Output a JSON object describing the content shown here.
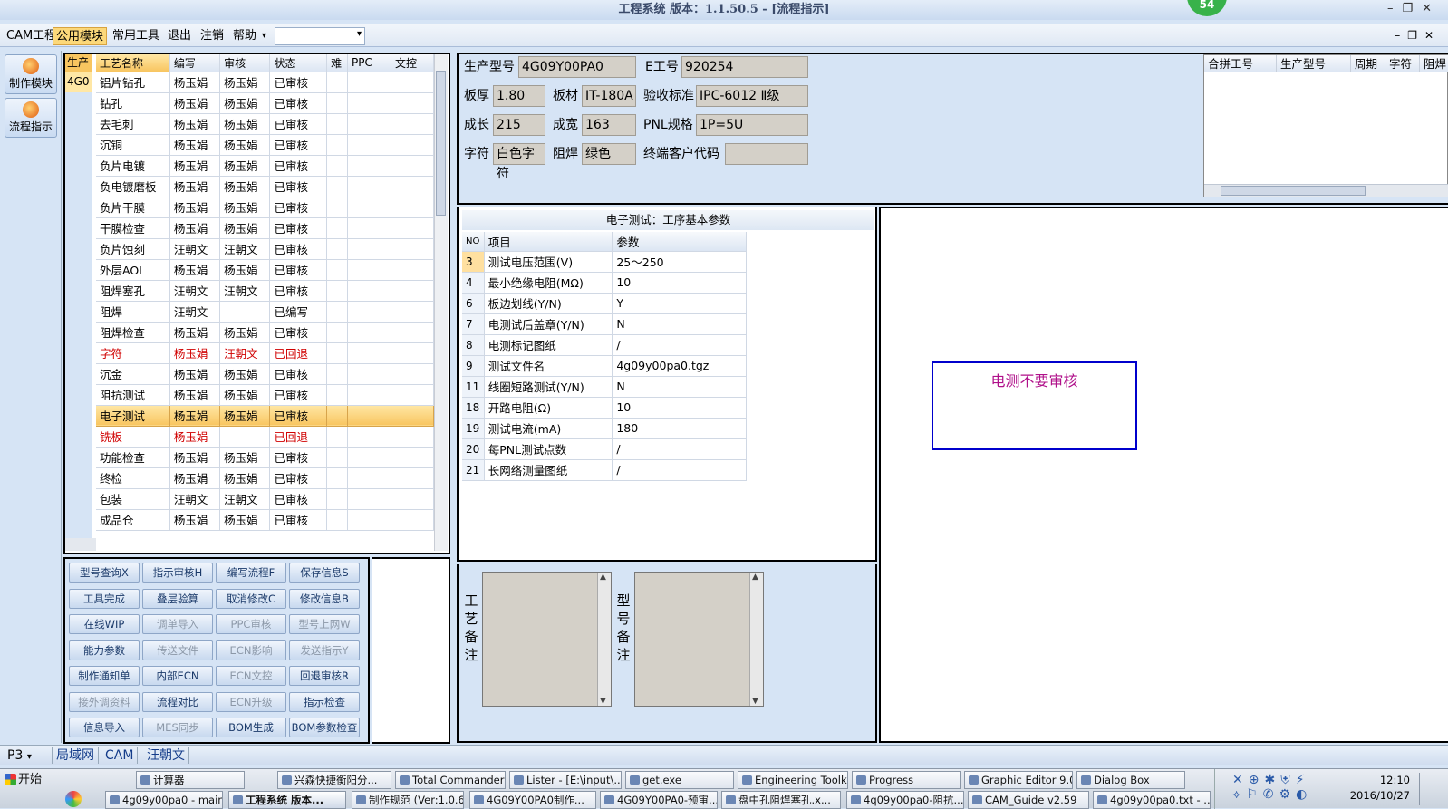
{
  "window": {
    "title": "工程系统  版本：1.1.50.5 - [流程指示]",
    "badge": "54"
  },
  "menu": {
    "items": [
      "CAM工程",
      "公用模块",
      "常用工具",
      "退出",
      "注销",
      "帮助"
    ],
    "active_index": 1,
    "dropdown_arrow": "▾"
  },
  "rail": {
    "buttons": [
      "制作模块",
      "流程指示"
    ]
  },
  "prod_column": {
    "header": "生产",
    "value": "4G0"
  },
  "process_table": {
    "headers": [
      "工艺名称",
      "编写",
      "审核",
      "状态",
      "难",
      "PPC",
      "文控"
    ],
    "rows": [
      [
        "铝片钻孔",
        "杨玉娟",
        "杨玉娟",
        "已审核"
      ],
      [
        "钻孔",
        "杨玉娟",
        "杨玉娟",
        "已审核"
      ],
      [
        "去毛刺",
        "杨玉娟",
        "杨玉娟",
        "已审核"
      ],
      [
        "沉铜",
        "杨玉娟",
        "杨玉娟",
        "已审核"
      ],
      [
        "负片电镀",
        "杨玉娟",
        "杨玉娟",
        "已审核"
      ],
      [
        "负电镀磨板",
        "杨玉娟",
        "杨玉娟",
        "已审核"
      ],
      [
        "负片干膜",
        "杨玉娟",
        "杨玉娟",
        "已审核"
      ],
      [
        "干膜检查",
        "杨玉娟",
        "杨玉娟",
        "已审核"
      ],
      [
        "负片蚀刻",
        "汪朝文",
        "汪朝文",
        "已审核"
      ],
      [
        "外层AOI",
        "杨玉娟",
        "杨玉娟",
        "已审核"
      ],
      [
        "阻焊塞孔",
        "汪朝文",
        "汪朝文",
        "已审核"
      ],
      [
        "阻焊",
        "汪朝文",
        "",
        "已编写"
      ],
      [
        "阻焊检查",
        "杨玉娟",
        "杨玉娟",
        "已审核"
      ],
      [
        "字符",
        "杨玉娟",
        "汪朝文",
        "已回退"
      ],
      [
        "沉金",
        "杨玉娟",
        "杨玉娟",
        "已审核"
      ],
      [
        "阻抗测试",
        "杨玉娟",
        "杨玉娟",
        "已审核"
      ],
      [
        "电子测试",
        "杨玉娟",
        "杨玉娟",
        "已审核"
      ],
      [
        "铣板",
        "杨玉娟",
        "",
        "已回退"
      ],
      [
        "功能检查",
        "杨玉娟",
        "杨玉娟",
        "已审核"
      ],
      [
        "终检",
        "杨玉娟",
        "杨玉娟",
        "已审核"
      ],
      [
        "包装",
        "汪朝文",
        "汪朝文",
        "已审核"
      ],
      [
        "成品仓",
        "杨玉娟",
        "杨玉娟",
        "已审核"
      ]
    ],
    "red_rows": [
      13,
      17
    ],
    "selected_row": 16
  },
  "buttons": [
    [
      "型号查询X",
      "指示审核H",
      "编写流程F",
      "保存信息S"
    ],
    [
      "工具完成",
      "叠层验算",
      "取消修改C",
      "修改信息B"
    ],
    [
      "在线WIP",
      "调单导入",
      "PPC审核",
      "型号上网W"
    ],
    [
      "能力参数",
      "传送文件",
      "ECN影响",
      "发送指示Y"
    ],
    [
      "制作通知单",
      "内部ECN",
      "ECN文控",
      "回退审核R"
    ],
    [
      "接外调资料",
      "流程对比",
      "ECN升级",
      "指示检查"
    ],
    [
      "信息导入",
      "MES同步",
      "BOM生成",
      "BOM参数检查"
    ]
  ],
  "disabled_buttons": [
    "调单导入",
    "PPC审核",
    "型号上网W",
    "传送文件",
    "ECN影响",
    "发送指示Y",
    "ECN文控",
    "接外调资料",
    "ECN升级",
    "MES同步"
  ],
  "info": {
    "prod_model_label": "生产型号",
    "prod_model": "4G09Y00PA0",
    "e_no_label": "E工号",
    "e_no": "920254",
    "thickness_label": "板厚",
    "thickness": "1.80",
    "material_label": "板材",
    "material": "IT-180A",
    "standard_label": "验收标准",
    "standard": "IPC-6012 Ⅱ级",
    "length_label": "成长",
    "length": "215",
    "width_label": "成宽",
    "width": "163",
    "pnl_label": "PNL规格",
    "pnl": "1P=5U",
    "char_label": "字符",
    "char": "白色字符",
    "mask_label": "阻焊",
    "mask": "绿色",
    "customer_label": "终端客户代码",
    "customer": ""
  },
  "merge_table": {
    "headers": [
      "合拼工号",
      "生产型号",
      "周期",
      "字符",
      "阻焊"
    ]
  },
  "test_params": {
    "title": "电子测试：工序基本参数",
    "headers": [
      "NO",
      "项目",
      "参数"
    ],
    "rows": [
      [
        "3",
        "测试电压范围(V)",
        "25～250"
      ],
      [
        "4",
        "最小绝缘电阻(MΩ)",
        "10"
      ],
      [
        "6",
        "板边划线(Y/N)",
        "Y"
      ],
      [
        "7",
        "电测试后盖章(Y/N)",
        "N"
      ],
      [
        "8",
        "电测标记图纸",
        "/"
      ],
      [
        "9",
        "测试文件名",
        "4g09y00pa0.tgz"
      ],
      [
        "11",
        "线圈短路测试(Y/N)",
        "N"
      ],
      [
        "18",
        "开路电阻(Ω)",
        "10"
      ],
      [
        "19",
        "测试电流(mA)",
        "180"
      ],
      [
        "20",
        "每PNL测试点数",
        "/"
      ],
      [
        "21",
        "长网络测量图纸",
        "/"
      ]
    ]
  },
  "notes": {
    "process_label": "工艺备注",
    "model_label": "型号备注"
  },
  "hint_text": "电测不要审核",
  "statusbar": {
    "items": [
      "P3",
      "局域网",
      "CAM",
      "汪朝文"
    ]
  },
  "taskbar": {
    "start": "开始",
    "row1": [
      "计算器",
      "兴森快捷衡阳分...",
      "Total Commander ...",
      "Lister - [E:\\input\\...",
      "get.exe",
      "Engineering Toolki...",
      "Progress",
      "Graphic Editor 9.0...",
      "Dialog Box"
    ],
    "row2": [
      "4g09y00pa0 - main...",
      "工程系统  版本...",
      "制作规范 (Ver:1.0.6)",
      "4G09Y00PA0制作...",
      "4G09Y00PA0-预审...",
      "盘中孔阻焊塞孔.x...",
      "4q09y00pa0-阻抗...",
      "CAM_Guide v2.59",
      "4g09y00pa0.txt - ..."
    ],
    "active_row2": 1,
    "time": "12:10",
    "date": "2016/10/27"
  }
}
